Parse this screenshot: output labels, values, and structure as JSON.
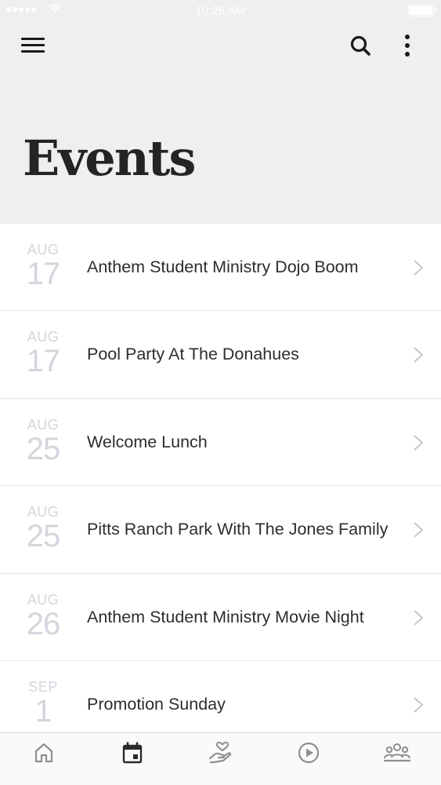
{
  "status_bar": {
    "time": "10:26 AM"
  },
  "header": {
    "title": "Events",
    "menu_icon": "hamburger-menu-icon",
    "search_icon": "search-icon",
    "more_icon": "more-vertical-icon"
  },
  "events": [
    {
      "month": "AUG",
      "day": "17",
      "title": "Anthem Student Ministry Dojo Boom"
    },
    {
      "month": "AUG",
      "day": "17",
      "title": "Pool Party At The Donahues"
    },
    {
      "month": "AUG",
      "day": "25",
      "title": "Welcome Lunch"
    },
    {
      "month": "AUG",
      "day": "25",
      "title": "Pitts Ranch Park With The Jones Family"
    },
    {
      "month": "AUG",
      "day": "26",
      "title": "Anthem Student Ministry Movie Night"
    },
    {
      "month": "SEP",
      "day": "1",
      "title": "Promotion Sunday"
    }
  ],
  "tab_bar": {
    "tabs": [
      {
        "icon": "home-icon",
        "active": false
      },
      {
        "icon": "calendar-icon",
        "active": true
      },
      {
        "icon": "giving-hand-heart-icon",
        "active": false
      },
      {
        "icon": "play-circle-icon",
        "active": false
      },
      {
        "icon": "people-group-icon",
        "active": false
      }
    ]
  },
  "colors": {
    "header_bg": "#efeef0",
    "date_text": "#d8d3dc",
    "tab_inactive": "#8e8e93",
    "tab_active": "#2b2b2b"
  }
}
